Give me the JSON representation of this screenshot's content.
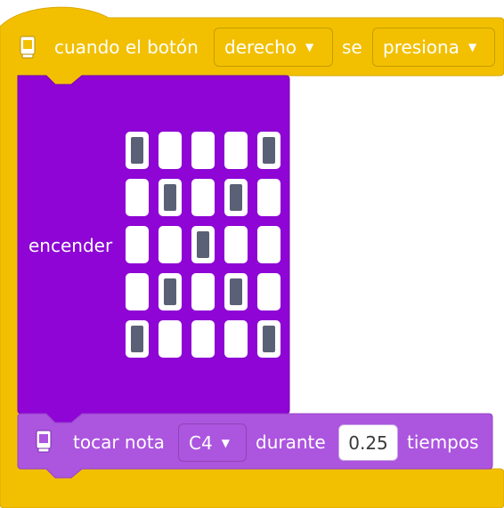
{
  "hat_block": {
    "label_prefix": "cuando el botón",
    "button_value": "derecho",
    "label_mid": "se",
    "event_value": "presiona",
    "icon": "microbit-board-icon"
  },
  "led_block": {
    "label": "encender",
    "grid": [
      [
        1,
        0,
        0,
        0,
        1
      ],
      [
        0,
        1,
        0,
        1,
        0
      ],
      [
        0,
        0,
        1,
        0,
        0
      ],
      [
        0,
        1,
        0,
        1,
        0
      ],
      [
        1,
        0,
        0,
        0,
        1
      ]
    ]
  },
  "sound_block": {
    "label_prefix": "tocar nota",
    "note_value": "C4",
    "label_mid": "durante",
    "beats_value": "0.25",
    "label_suffix": "tiempos",
    "icon": "microbit-board-icon"
  },
  "colors": {
    "events": "#f2c000",
    "events_border": "#d9a700",
    "led": "#8e05d5",
    "led_border": "#7a00b8",
    "sound": "#ac55df",
    "sound_border": "#9442c7",
    "led_on": "#5a6075"
  }
}
